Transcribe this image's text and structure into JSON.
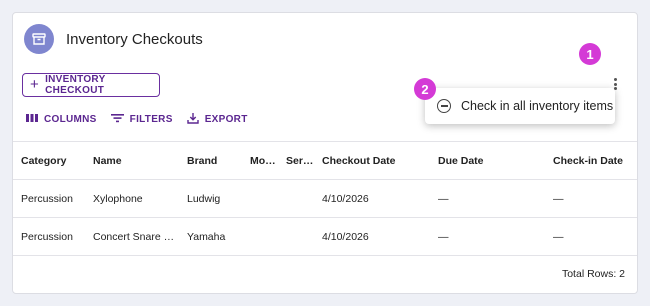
{
  "header": {
    "title": "Inventory Checkouts",
    "icon": "archive-box-icon"
  },
  "actions": {
    "checkout_label": "INVENTORY CHECKOUT"
  },
  "toolbar": {
    "columns": "COLUMNS",
    "filters": "FILTERS",
    "export": "EXPORT"
  },
  "menu": {
    "check_in_all": "Check in all inventory items"
  },
  "badges": {
    "one": "1",
    "two": "2"
  },
  "table": {
    "columns": [
      "Category",
      "Name",
      "Brand",
      "Mo…",
      "Ser…",
      "Checkout Date",
      "Due Date",
      "Check-in Date"
    ],
    "rows": [
      [
        "Percussion",
        "Xylophone",
        "Ludwig",
        "",
        "",
        "4/10/2026",
        "—",
        "—"
      ],
      [
        "Percussion",
        "Concert Snare …",
        "Yamaha",
        "",
        "",
        "4/10/2026",
        "—",
        "—"
      ]
    ]
  },
  "footer": {
    "total_rows": "Total Rows: 2"
  },
  "colors": {
    "accent": "#5b2690",
    "badge": "#d43ad6",
    "avatar": "#7f86cf"
  }
}
